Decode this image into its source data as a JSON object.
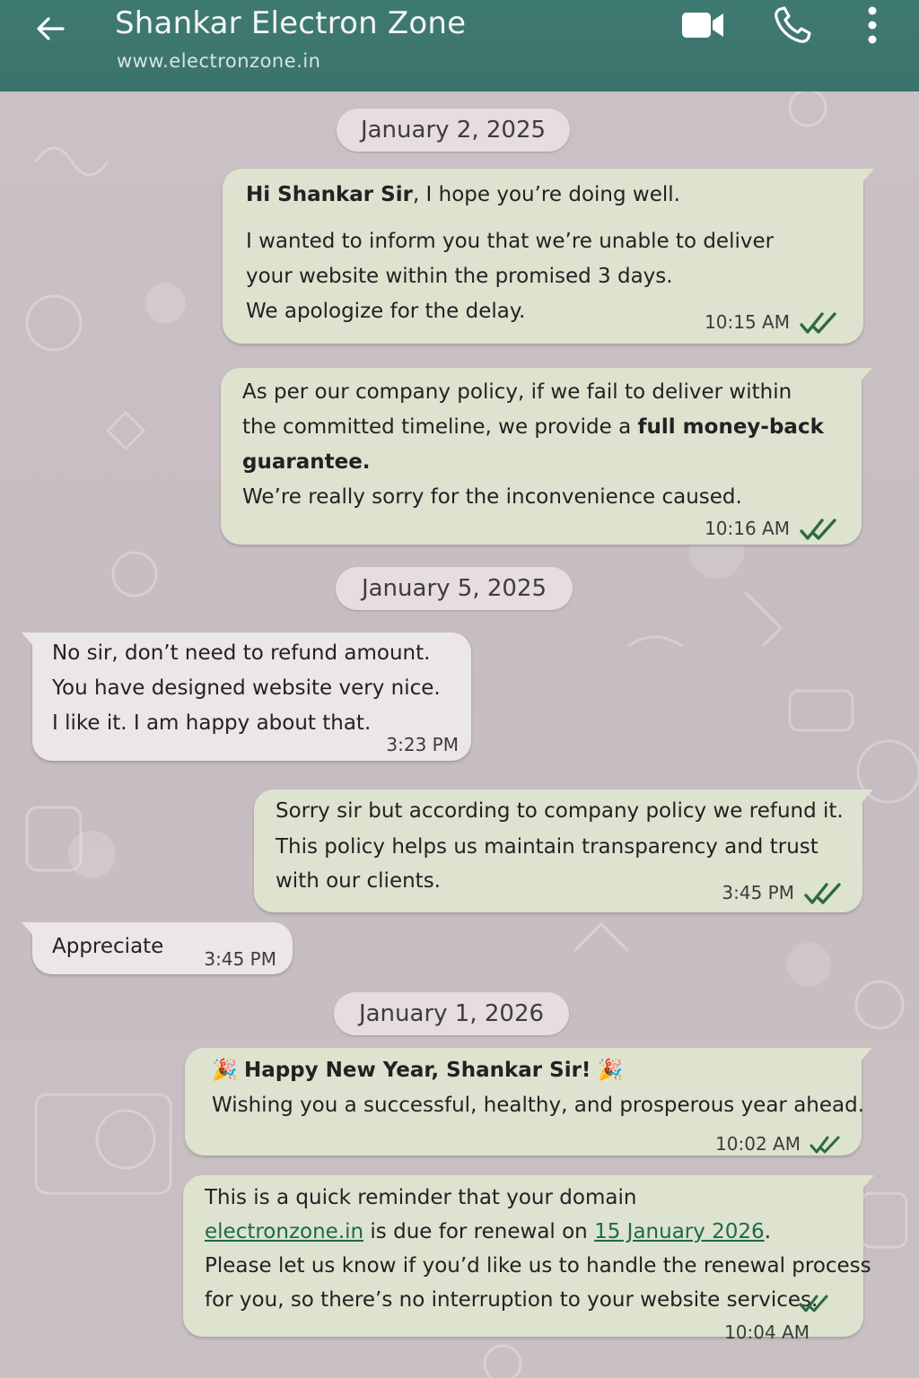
{
  "header": {
    "title": "Shankar Electron Zone",
    "subtitle": "www.electronzone.in",
    "back_icon": "arrow-left-icon",
    "video_icon": "video-camera-icon",
    "call_icon": "phone-icon",
    "more_icon": "vertical-ellipsis-icon",
    "bg_color": "#3a736b"
  },
  "dates": {
    "d1": "January 2, 2025",
    "d2": "January 5, 2025",
    "d3": "January 1, 2026"
  },
  "messages": {
    "m1": {
      "greeting_bold": "Hi Shankar Sir",
      "greeting_rest": ", I hope you’re doing well.",
      "l2": "I wanted to inform you that we’re unable to deliver",
      "l3": "your website within the promised 3 days.",
      "l4": "We apologize for the delay.",
      "time": "10:15 AM"
    },
    "m2": {
      "l1": "As per our company policy, if we fail to deliver within",
      "l2a": "the committed timeline, we provide a ",
      "l2b": "full money-back",
      "l3": "guarantee.",
      "l4": "We’re really sorry for the inconvenience caused.",
      "time": "10:16 AM"
    },
    "m3": {
      "l1": "No sir, don’t need to refund amount.",
      "l2": "You have designed website very nice.",
      "l3": "I like it. I am happy about that.",
      "time": "3:23 PM"
    },
    "m4": {
      "l1": "Sorry sir but according to company policy we refund it.",
      "l2": "This policy helps us maintain transparency and trust",
      "l3": "with our clients.",
      "time": "3:45 PM"
    },
    "m5": {
      "l1": "Appreciate",
      "time": "3:45 PM"
    },
    "m6": {
      "emoji": "🎉",
      "l1": "Happy New Year, Shankar Sir!",
      "l2": "Wishing you a successful, healthy, and prosperous year ahead.",
      "time": "10:02 AM"
    },
    "m7": {
      "l1": "This is a quick reminder that your domain",
      "domain": "electronzone.in",
      "l2_mid": " is due for renewal on ",
      "date_link": "15 January 2026",
      "l2_end": ".",
      "l3": "Please let us know if you’d like us to handle the renewal process",
      "l4": "for you, so there’s no interruption to your website services.",
      "time": "10:04 AM"
    }
  },
  "status": {
    "read_icon": "double-check-icon",
    "read_color": "#2c6b3f"
  }
}
